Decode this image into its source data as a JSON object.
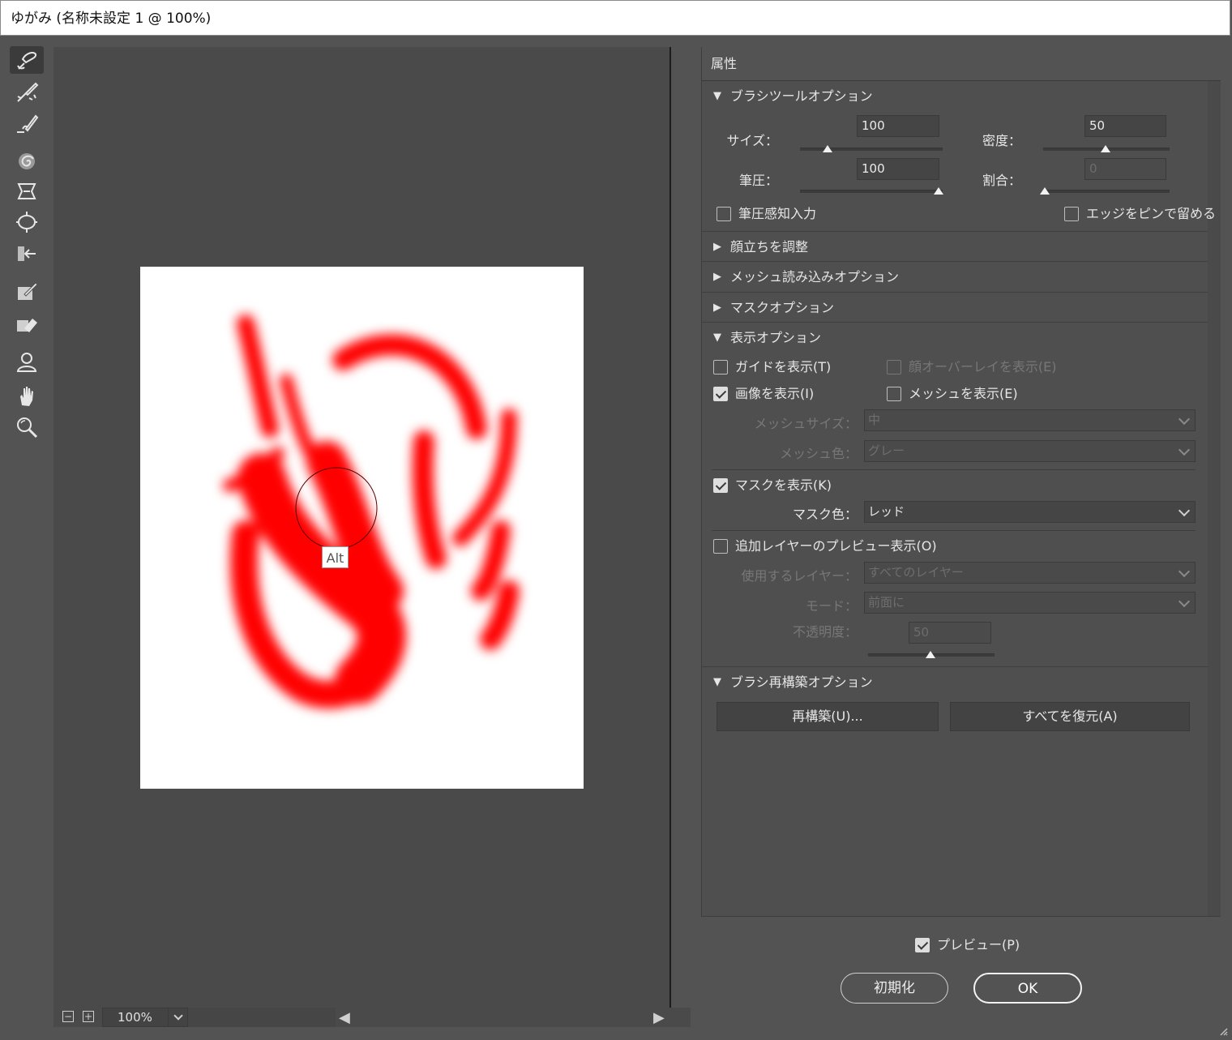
{
  "window": {
    "title": "ゆがみ (名称未設定 1 @ 100%)"
  },
  "canvas": {
    "tooltip": "Alt",
    "zoom": "100%"
  },
  "panel": {
    "title": "属性",
    "brush_tool_options": {
      "header": "ブラシツールオプション",
      "size_label": "サイズ：",
      "size_value": "100",
      "size_fraction": 0.19,
      "density_label": "密度：",
      "density_value": "50",
      "density_fraction": 0.5,
      "pressure_label": "筆圧：",
      "pressure_value": "100",
      "pressure_fraction": 1.0,
      "rate_label": "割合：",
      "rate_value": "0",
      "rate_fraction": 0.0,
      "stylus_label": "筆圧感知入力",
      "stylus_checked": false,
      "pin_edges_label": "エッジをピンで留める",
      "pin_edges_checked": false
    },
    "collapsed_sections": [
      "顔立ちを調整",
      "メッシュ読み込みオプション",
      "マスクオプション"
    ],
    "view_options": {
      "header": "表示オプション",
      "show_guides": {
        "label": "ガイドを表示(T)",
        "checked": false
      },
      "show_face_overlay": {
        "label": "顔オーバーレイを表示(E)",
        "checked": false,
        "disabled": true
      },
      "show_image": {
        "label": "画像を表示(I)",
        "checked": true
      },
      "show_mesh": {
        "label": "メッシュを表示(E)",
        "checked": false
      },
      "mesh_size_label": "メッシュサイズ：",
      "mesh_size_value": "中",
      "mesh_color_label": "メッシュ色：",
      "mesh_color_value": "グレー",
      "show_mask": {
        "label": "マスクを表示(K)",
        "checked": true
      },
      "mask_color_label": "マスク色：",
      "mask_color_value": "レッド",
      "show_backdrop": {
        "label": "追加レイヤーのプレビュー表示(O)",
        "checked": false
      },
      "use_layer_label": "使用するレイヤー：",
      "use_layer_value": "すべてのレイヤー",
      "mode_label": "モード：",
      "mode_value": "前面に",
      "opacity_label": "不透明度：",
      "opacity_value": "50",
      "opacity_fraction": 0.5
    },
    "brush_reconstruct": {
      "header": "ブラシ再構築オプション",
      "reconstruct_label": "再構築(U)...",
      "restore_all_label": "すべてを復元(A)"
    }
  },
  "footer": {
    "preview_label": "プレビュー(P)",
    "preview_checked": true,
    "reset_label": "初期化",
    "ok_label": "OK"
  },
  "tools": [
    "forward-warp",
    "reconstruct",
    "smooth",
    "twirl",
    "pucker",
    "bloat",
    "push-left",
    "freeze-mask",
    "thaw-mask",
    "face",
    "hand",
    "zoom"
  ],
  "colors": {
    "mask": "#ff0000",
    "ui_bg": "#535353"
  }
}
